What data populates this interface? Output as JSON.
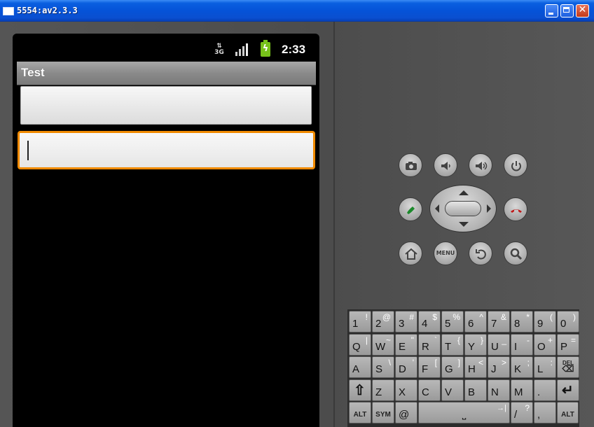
{
  "window": {
    "title": "5554:av2.3.3"
  },
  "status_bar": {
    "network_label_top": "⇅",
    "network_label": "3G",
    "clock": "2:33"
  },
  "app": {
    "title": "Test"
  },
  "fields": {
    "first_value": "",
    "second_value": ""
  },
  "controls": {
    "menu_label": "MENU"
  },
  "keyboard": {
    "rows": [
      [
        {
          "k": "1",
          "alt": "!"
        },
        {
          "k": "2",
          "alt": "@"
        },
        {
          "k": "3",
          "alt": "#"
        },
        {
          "k": "4",
          "alt": "$"
        },
        {
          "k": "5",
          "alt": "%"
        },
        {
          "k": "6",
          "alt": "^"
        },
        {
          "k": "7",
          "alt": "&"
        },
        {
          "k": "8",
          "alt": "*"
        },
        {
          "k": "9",
          "alt": "("
        },
        {
          "k": "0",
          "alt": ")"
        }
      ],
      [
        {
          "k": "Q",
          "alt": "|"
        },
        {
          "k": "W",
          "alt": "~"
        },
        {
          "k": "E",
          "alt": "\""
        },
        {
          "k": "R",
          "alt": "`"
        },
        {
          "k": "T",
          "alt": "{"
        },
        {
          "k": "Y",
          "alt": "}"
        },
        {
          "k": "U",
          "alt": "_"
        },
        {
          "k": "I",
          "alt": "-"
        },
        {
          "k": "O",
          "alt": "+"
        },
        {
          "k": "P",
          "alt": "="
        }
      ],
      [
        {
          "k": "A",
          "alt": ""
        },
        {
          "k": "S",
          "alt": "\\"
        },
        {
          "k": "D",
          "alt": "'"
        },
        {
          "k": "F",
          "alt": "["
        },
        {
          "k": "G",
          "alt": "]"
        },
        {
          "k": "H",
          "alt": "<"
        },
        {
          "k": "J",
          "alt": ">"
        },
        {
          "k": "K",
          "alt": ";"
        },
        {
          "k": "L",
          "alt": ":"
        },
        {
          "k": "DEL",
          "alt": ""
        }
      ],
      [
        {
          "k": "⇧",
          "alt": ""
        },
        {
          "k": "Z",
          "alt": ""
        },
        {
          "k": "X",
          "alt": ""
        },
        {
          "k": "C",
          "alt": ""
        },
        {
          "k": "V",
          "alt": ""
        },
        {
          "k": "B",
          "alt": ""
        },
        {
          "k": "N",
          "alt": ""
        },
        {
          "k": "M",
          "alt": ""
        },
        {
          "k": ".",
          "alt": ""
        },
        {
          "k": "↵",
          "alt": ""
        }
      ],
      [
        {
          "k": "ALT",
          "alt": ""
        },
        {
          "k": "SYM",
          "alt": ""
        },
        {
          "k": "@",
          "alt": ""
        },
        {
          "k": "⎵",
          "alt": ""
        },
        {
          "k": "/",
          "alt": "?"
        },
        {
          "k": ",",
          "alt": ""
        },
        {
          "k": "ALT",
          "alt": ""
        }
      ]
    ],
    "space_tab": "→|"
  }
}
